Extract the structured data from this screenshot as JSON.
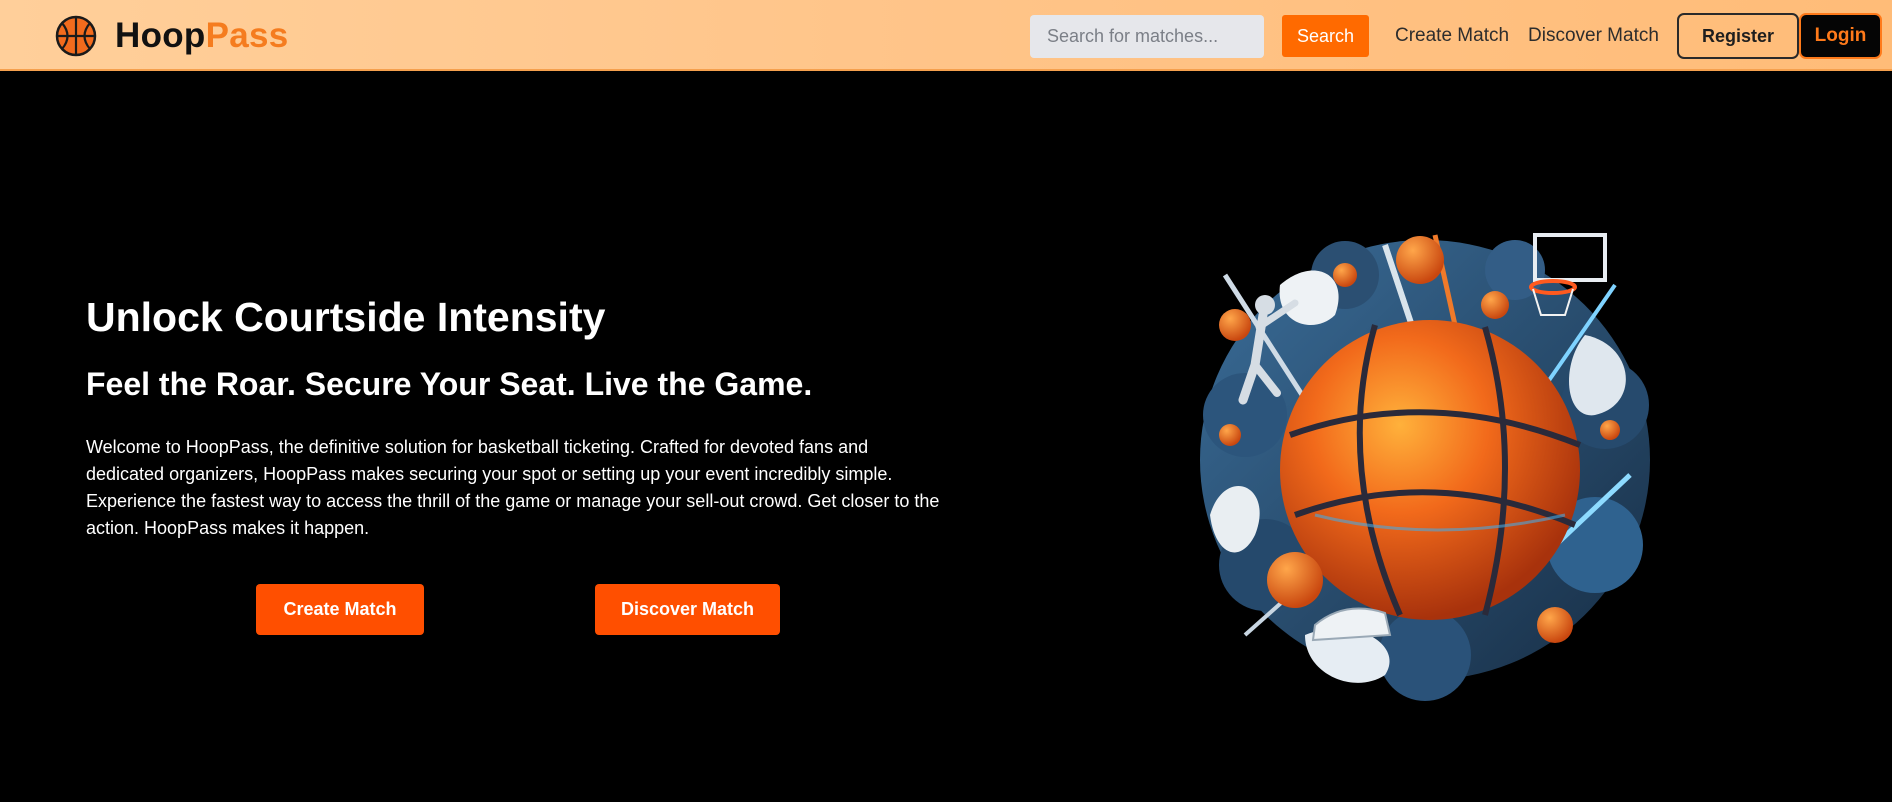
{
  "brand": {
    "name_part1": "Hoop",
    "name_part2": "Pass",
    "logo_icon": "basketball-icon",
    "colors": {
      "dark": "#111111",
      "accent": "#f57c1f"
    }
  },
  "nav": {
    "search_placeholder": "Search for matches...",
    "search_button": "Search",
    "links": [
      "Create Match",
      "Discover Match"
    ],
    "register": "Register",
    "login": "Login",
    "background_gradient": [
      "#ffcf9a",
      "#ffbc78"
    ]
  },
  "hero": {
    "title": "Unlock Courtside Intensity",
    "subtitle": "Feel the Roar. Secure Your Seat. Live the Game.",
    "description": "Welcome to HoopPass, the definitive solution for basketball ticketing. Crafted for devoted fans and dedicated organizers, HoopPass makes securing your spot or setting up your event incredibly simple. Experience the fastest way to access the thrill of the game or manage your sell-out crowd. Get closer to the action. HoopPass makes it happen.",
    "buttons": {
      "create": "Create Match",
      "discover": "Discover Match"
    },
    "art": "basketball-splash-illustration"
  },
  "colors": {
    "page_background": "#000000",
    "primary_button": "#ff4f00",
    "search_button": "#ff6a00",
    "login_accent": "#ff7a1a"
  }
}
